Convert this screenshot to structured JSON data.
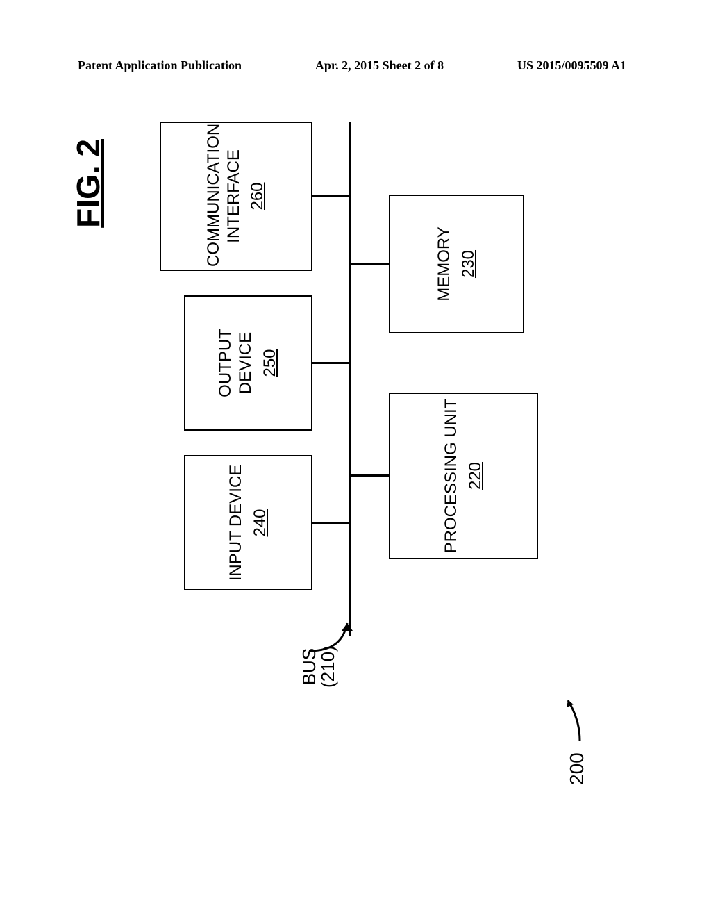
{
  "header": {
    "left": "Patent Application Publication",
    "center": "Apr. 2, 2015  Sheet 2 of 8",
    "right": "US 2015/0095509 A1"
  },
  "figure": {
    "title": "FIG. 2",
    "ref_main": "200",
    "bus_label_line1": "BUS",
    "bus_label_line2": "(210)"
  },
  "blocks": {
    "input": {
      "label": "INPUT DEVICE",
      "num": "240"
    },
    "output": {
      "label": "OUTPUT DEVICE",
      "num": "250"
    },
    "comm": {
      "label_l1": "COMMUNICATION",
      "label_l2": "INTERFACE",
      "num": "260"
    },
    "proc": {
      "label": "PROCESSING UNIT",
      "num": "220"
    },
    "mem": {
      "label": "MEMORY",
      "num": "230"
    }
  }
}
